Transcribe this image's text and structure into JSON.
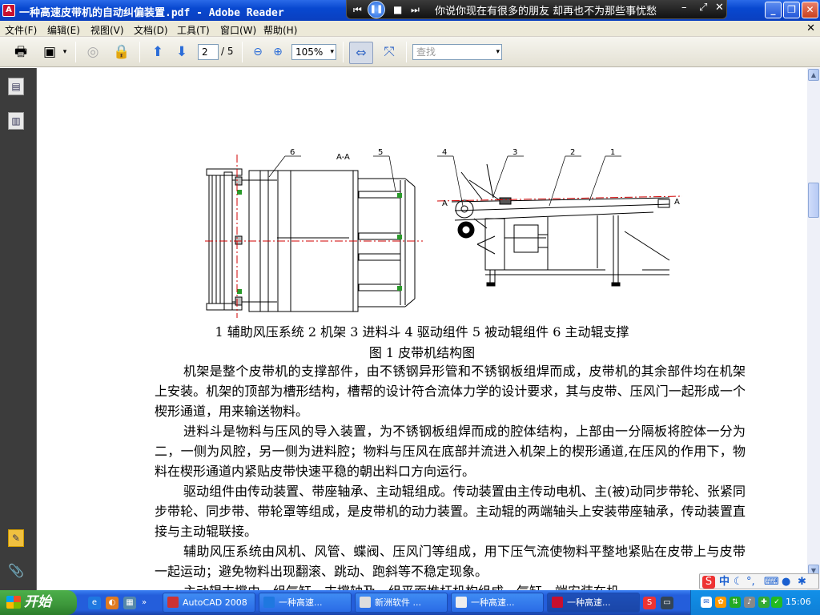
{
  "window": {
    "title": "一种高速皮带机的自动纠偏装置.pdf - Adobe Reader"
  },
  "media_player": {
    "song": "你说你现在有很多的朋友 却再也不为那些事忧愁"
  },
  "menu": [
    "文件(F)",
    "编辑(E)",
    "视图(V)",
    "文档(D)",
    "工具(T)",
    "窗口(W)",
    "帮助(H)"
  ],
  "toolbar": {
    "current_page": "2",
    "page_total": "/ 5",
    "zoom": "105%",
    "search_placeholder": "查找"
  },
  "figure": {
    "section_label": "A-A",
    "callouts": [
      "6",
      "5",
      "4",
      "3",
      "2",
      "1"
    ],
    "section_marks": [
      "A",
      "A"
    ],
    "caption": "1 辅助风压系统 2 机架 3 进料斗 4 驱动组件 5 被动辊组件 6 主动辊支撑",
    "title": "图 1   皮带机结构图"
  },
  "paragraphs": [
    "机架是整个皮带机的支撑部件，由不锈钢异形管和不锈钢板组焊而成，皮带机的其余部件均在机架上安装。机架的顶部为槽形结构，槽帮的设计符合流体力学的设计要求，其与皮带、压风门一起形成一个楔形通道，用来输送物料。",
    "进料斗是物料与压风的导入装置，为不锈钢板组焊而成的腔体结构，上部由一分隔板将腔体一分为二，一侧为风腔，另一侧为进料腔；物料与压风在底部并流进入机架上的楔形通道,在压风的作用下，物料在楔形通道内紧贴皮带快速平稳的朝出料口方向运行。",
    "驱动组件由传动装置、带座轴承、主动辊组成。传动装置由主传动电机、主(被)动同步带轮、张紧同步带轮、同步带、带轮罩等组成，是皮带机的动力装置。主动辊的两端轴头上安装带座轴承，传动装置直接与主动辊联接。",
    "辅助风压系统由风机、风管、蝶阀、压风门等组成，用下压气流使物料平整地紧贴在皮带上与皮带一起运动；避免物料出现翻滚、跳动、跑斜等不稳定现象。",
    "主动辊支撑由一组气缸、支撑轴及一组平面推杆机构组成，气缸一端安装在机"
  ],
  "taskbar": {
    "start": "开始",
    "tasks": [
      "AutoCAD 2008",
      "一种高速...",
      "新洲软件 ...",
      "一种高速...",
      "一种高速..."
    ],
    "clock": "15:06"
  },
  "ime": {
    "mode": "中"
  },
  "colors": {
    "titlebar": "#0a4ad0",
    "taskbar": "#245edb",
    "start_button": "#3c963a",
    "nav_panel": "#3c3c3c",
    "centerline": "#d00000"
  }
}
